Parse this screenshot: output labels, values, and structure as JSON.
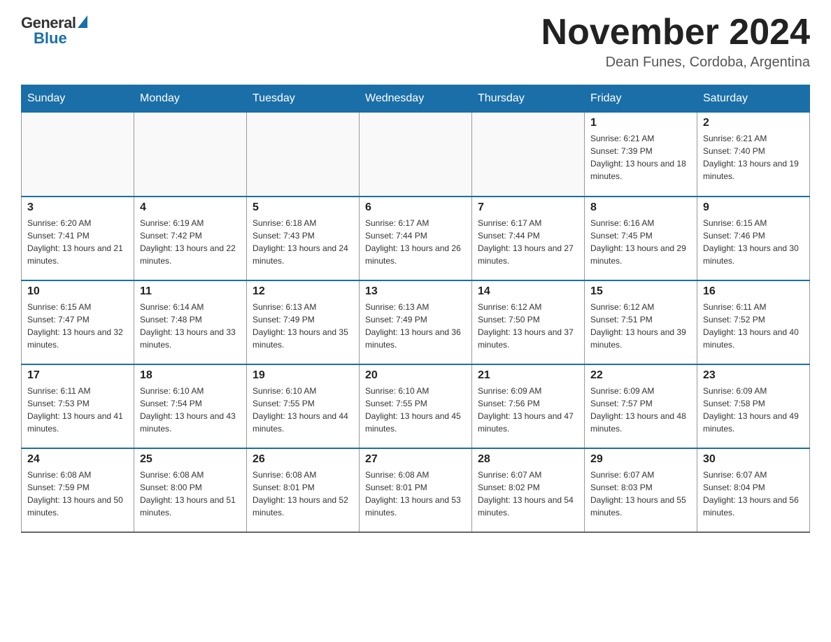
{
  "logo": {
    "general": "General",
    "blue": "Blue"
  },
  "title": "November 2024",
  "location": "Dean Funes, Cordoba, Argentina",
  "days_of_week": [
    "Sunday",
    "Monday",
    "Tuesday",
    "Wednesday",
    "Thursday",
    "Friday",
    "Saturday"
  ],
  "weeks": [
    [
      {
        "day": "",
        "info": ""
      },
      {
        "day": "",
        "info": ""
      },
      {
        "day": "",
        "info": ""
      },
      {
        "day": "",
        "info": ""
      },
      {
        "day": "",
        "info": ""
      },
      {
        "day": "1",
        "info": "Sunrise: 6:21 AM\nSunset: 7:39 PM\nDaylight: 13 hours and 18 minutes."
      },
      {
        "day": "2",
        "info": "Sunrise: 6:21 AM\nSunset: 7:40 PM\nDaylight: 13 hours and 19 minutes."
      }
    ],
    [
      {
        "day": "3",
        "info": "Sunrise: 6:20 AM\nSunset: 7:41 PM\nDaylight: 13 hours and 21 minutes."
      },
      {
        "day": "4",
        "info": "Sunrise: 6:19 AM\nSunset: 7:42 PM\nDaylight: 13 hours and 22 minutes."
      },
      {
        "day": "5",
        "info": "Sunrise: 6:18 AM\nSunset: 7:43 PM\nDaylight: 13 hours and 24 minutes."
      },
      {
        "day": "6",
        "info": "Sunrise: 6:17 AM\nSunset: 7:44 PM\nDaylight: 13 hours and 26 minutes."
      },
      {
        "day": "7",
        "info": "Sunrise: 6:17 AM\nSunset: 7:44 PM\nDaylight: 13 hours and 27 minutes."
      },
      {
        "day": "8",
        "info": "Sunrise: 6:16 AM\nSunset: 7:45 PM\nDaylight: 13 hours and 29 minutes."
      },
      {
        "day": "9",
        "info": "Sunrise: 6:15 AM\nSunset: 7:46 PM\nDaylight: 13 hours and 30 minutes."
      }
    ],
    [
      {
        "day": "10",
        "info": "Sunrise: 6:15 AM\nSunset: 7:47 PM\nDaylight: 13 hours and 32 minutes."
      },
      {
        "day": "11",
        "info": "Sunrise: 6:14 AM\nSunset: 7:48 PM\nDaylight: 13 hours and 33 minutes."
      },
      {
        "day": "12",
        "info": "Sunrise: 6:13 AM\nSunset: 7:49 PM\nDaylight: 13 hours and 35 minutes."
      },
      {
        "day": "13",
        "info": "Sunrise: 6:13 AM\nSunset: 7:49 PM\nDaylight: 13 hours and 36 minutes."
      },
      {
        "day": "14",
        "info": "Sunrise: 6:12 AM\nSunset: 7:50 PM\nDaylight: 13 hours and 37 minutes."
      },
      {
        "day": "15",
        "info": "Sunrise: 6:12 AM\nSunset: 7:51 PM\nDaylight: 13 hours and 39 minutes."
      },
      {
        "day": "16",
        "info": "Sunrise: 6:11 AM\nSunset: 7:52 PM\nDaylight: 13 hours and 40 minutes."
      }
    ],
    [
      {
        "day": "17",
        "info": "Sunrise: 6:11 AM\nSunset: 7:53 PM\nDaylight: 13 hours and 41 minutes."
      },
      {
        "day": "18",
        "info": "Sunrise: 6:10 AM\nSunset: 7:54 PM\nDaylight: 13 hours and 43 minutes."
      },
      {
        "day": "19",
        "info": "Sunrise: 6:10 AM\nSunset: 7:55 PM\nDaylight: 13 hours and 44 minutes."
      },
      {
        "day": "20",
        "info": "Sunrise: 6:10 AM\nSunset: 7:55 PM\nDaylight: 13 hours and 45 minutes."
      },
      {
        "day": "21",
        "info": "Sunrise: 6:09 AM\nSunset: 7:56 PM\nDaylight: 13 hours and 47 minutes."
      },
      {
        "day": "22",
        "info": "Sunrise: 6:09 AM\nSunset: 7:57 PM\nDaylight: 13 hours and 48 minutes."
      },
      {
        "day": "23",
        "info": "Sunrise: 6:09 AM\nSunset: 7:58 PM\nDaylight: 13 hours and 49 minutes."
      }
    ],
    [
      {
        "day": "24",
        "info": "Sunrise: 6:08 AM\nSunset: 7:59 PM\nDaylight: 13 hours and 50 minutes."
      },
      {
        "day": "25",
        "info": "Sunrise: 6:08 AM\nSunset: 8:00 PM\nDaylight: 13 hours and 51 minutes."
      },
      {
        "day": "26",
        "info": "Sunrise: 6:08 AM\nSunset: 8:01 PM\nDaylight: 13 hours and 52 minutes."
      },
      {
        "day": "27",
        "info": "Sunrise: 6:08 AM\nSunset: 8:01 PM\nDaylight: 13 hours and 53 minutes."
      },
      {
        "day": "28",
        "info": "Sunrise: 6:07 AM\nSunset: 8:02 PM\nDaylight: 13 hours and 54 minutes."
      },
      {
        "day": "29",
        "info": "Sunrise: 6:07 AM\nSunset: 8:03 PM\nDaylight: 13 hours and 55 minutes."
      },
      {
        "day": "30",
        "info": "Sunrise: 6:07 AM\nSunset: 8:04 PM\nDaylight: 13 hours and 56 minutes."
      }
    ]
  ]
}
